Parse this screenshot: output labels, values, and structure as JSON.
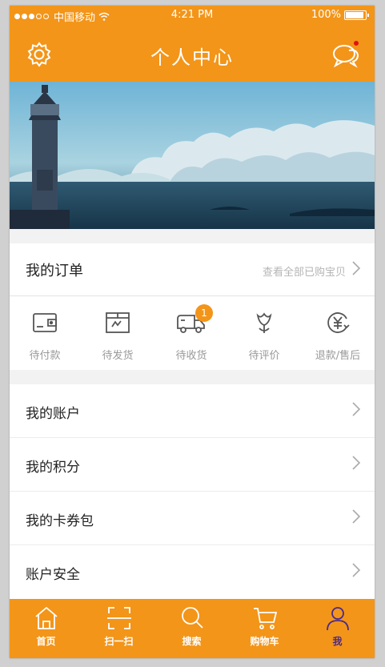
{
  "statusbar": {
    "carrier": "中国移动",
    "time": "4:21 PM",
    "battery": "100%",
    "battery_level": 1.0,
    "signal_filled": 3,
    "signal_total": 5
  },
  "navbar": {
    "title": "个人中心"
  },
  "orders": {
    "title": "我的订单",
    "view_all": "查看全部已购宝贝",
    "items": [
      {
        "label": "待付款",
        "icon": "wallet-icon"
      },
      {
        "label": "待发货",
        "icon": "package-icon"
      },
      {
        "label": "待收货",
        "icon": "truck-icon",
        "badge": "1"
      },
      {
        "label": "待评价",
        "icon": "flower-icon"
      },
      {
        "label": "退款/售后",
        "icon": "refund-icon"
      }
    ]
  },
  "menu": {
    "items": [
      {
        "label": "我的账户"
      },
      {
        "label": "我的积分"
      },
      {
        "label": "我的卡券包"
      },
      {
        "label": "账户安全"
      }
    ]
  },
  "tabs": [
    {
      "label": "首页",
      "icon": "home-icon"
    },
    {
      "label": "扫一扫",
      "icon": "scan-icon"
    },
    {
      "label": "搜索",
      "icon": "search-icon"
    },
    {
      "label": "购物车",
      "icon": "cart-icon"
    },
    {
      "label": "我",
      "icon": "user-icon",
      "active": true
    }
  ],
  "colors": {
    "accent": "#f39519",
    "active_tab": "#4a2a8a",
    "background": "#f2f2f2",
    "notification": "#e01010"
  }
}
